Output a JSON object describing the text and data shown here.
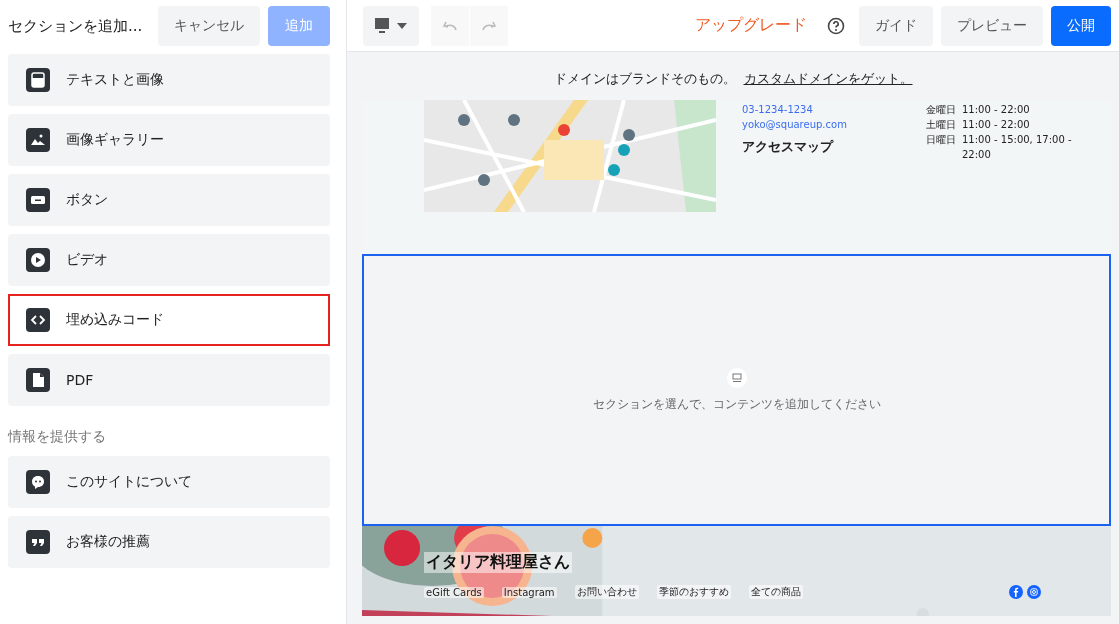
{
  "panel": {
    "title": "セクションを追加...",
    "cancel": "キャンセル",
    "add": "追加"
  },
  "sections": [
    {
      "items": [
        {
          "label": "テキストと画像",
          "kind": "text-image",
          "selected": false
        },
        {
          "label": "画像ギャラリー",
          "kind": "gallery",
          "selected": false
        },
        {
          "label": "ボタン",
          "kind": "button",
          "selected": false
        },
        {
          "label": "ビデオ",
          "kind": "video",
          "selected": false
        },
        {
          "label": "埋め込みコード",
          "kind": "code",
          "selected": true
        },
        {
          "label": "PDF",
          "kind": "pdf",
          "selected": false
        }
      ]
    },
    {
      "heading": "情報を提供する",
      "items": [
        {
          "label": "このサイトについて",
          "kind": "chat",
          "selected": false
        },
        {
          "label": "お客様の推薦",
          "kind": "quote",
          "selected": false
        }
      ]
    }
  ],
  "toolbar": {
    "upgrade": "アップグレード",
    "guide": "ガイド",
    "preview": "プレビュー",
    "publish": "公開"
  },
  "banner": {
    "text": "ドメインはブランドそのもの。",
    "link": "カスタムドメインをゲット。"
  },
  "contact": {
    "phone": "03-1234-1234",
    "email": "yoko@squareup.com",
    "map_heading": "アクセスマップ"
  },
  "hours": [
    {
      "day": "金曜日",
      "time": "11:00 - 22:00"
    },
    {
      "day": "土曜日",
      "time": "11:00 - 22:00"
    },
    {
      "day": "日曜日",
      "time": "11:00 - 15:00, 17:00 - 22:00"
    }
  ],
  "empty_section": {
    "hint": "セクションを選んで、コンテンツを追加してください"
  },
  "footer": {
    "title": "イタリア料理屋さん",
    "links": [
      "eGift Cards",
      "Instagram",
      "お問い合わせ",
      "季節のおすすめ",
      "全ての商品"
    ]
  }
}
